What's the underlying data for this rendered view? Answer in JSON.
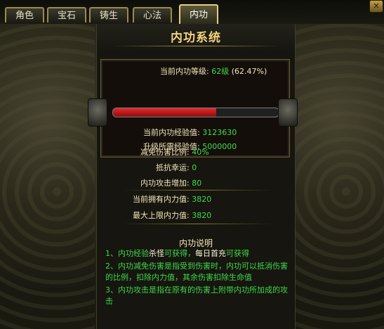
{
  "tabs": [
    {
      "label": "角色",
      "active": false
    },
    {
      "label": "宝石",
      "active": false
    },
    {
      "label": "铸生",
      "active": false
    },
    {
      "label": "心法",
      "active": false
    },
    {
      "label": "内功",
      "active": true
    }
  ],
  "close_glyph": "×",
  "panel": {
    "title": "内功系统",
    "level": {
      "label": "当前内功等级:",
      "value": "62级",
      "percent": "(62.47%)",
      "progress_fraction": 0.6247
    },
    "current_exp": {
      "label": "当前内功经验值:",
      "value": "3123630"
    },
    "required_exp": {
      "label": "升级所需经验值:",
      "value": "5000000"
    },
    "stats": [
      {
        "label": "减免伤害比例:",
        "value": "40%"
      },
      {
        "label": "抵抗幸运:",
        "value": "0"
      },
      {
        "label": "内功攻击增加:",
        "value": "80"
      },
      {
        "label": "当前拥有内力值:",
        "value": "3820"
      },
      {
        "label": "最大上限内力值:",
        "value": "3820"
      }
    ],
    "description": {
      "title": "内功说明",
      "line1": {
        "a": "1、内功经验",
        "b": "杀怪",
        "c": "可获得，",
        "d": "每日首充",
        "e": "可获得"
      },
      "line2": "2、内功减免伤害是指受到伤害时，内功可以抵消伤害的比例，扣除内力值，其余伤害扣除生命值",
      "line3": "3、内功攻击是指在原有的伤害上附带内功所加成的攻击"
    }
  },
  "colors": {
    "value_green": "#40dc4a",
    "label_cream": "#f3e7b8",
    "title_gold": "#f2d37a",
    "bar_red": "#e22a2a"
  }
}
